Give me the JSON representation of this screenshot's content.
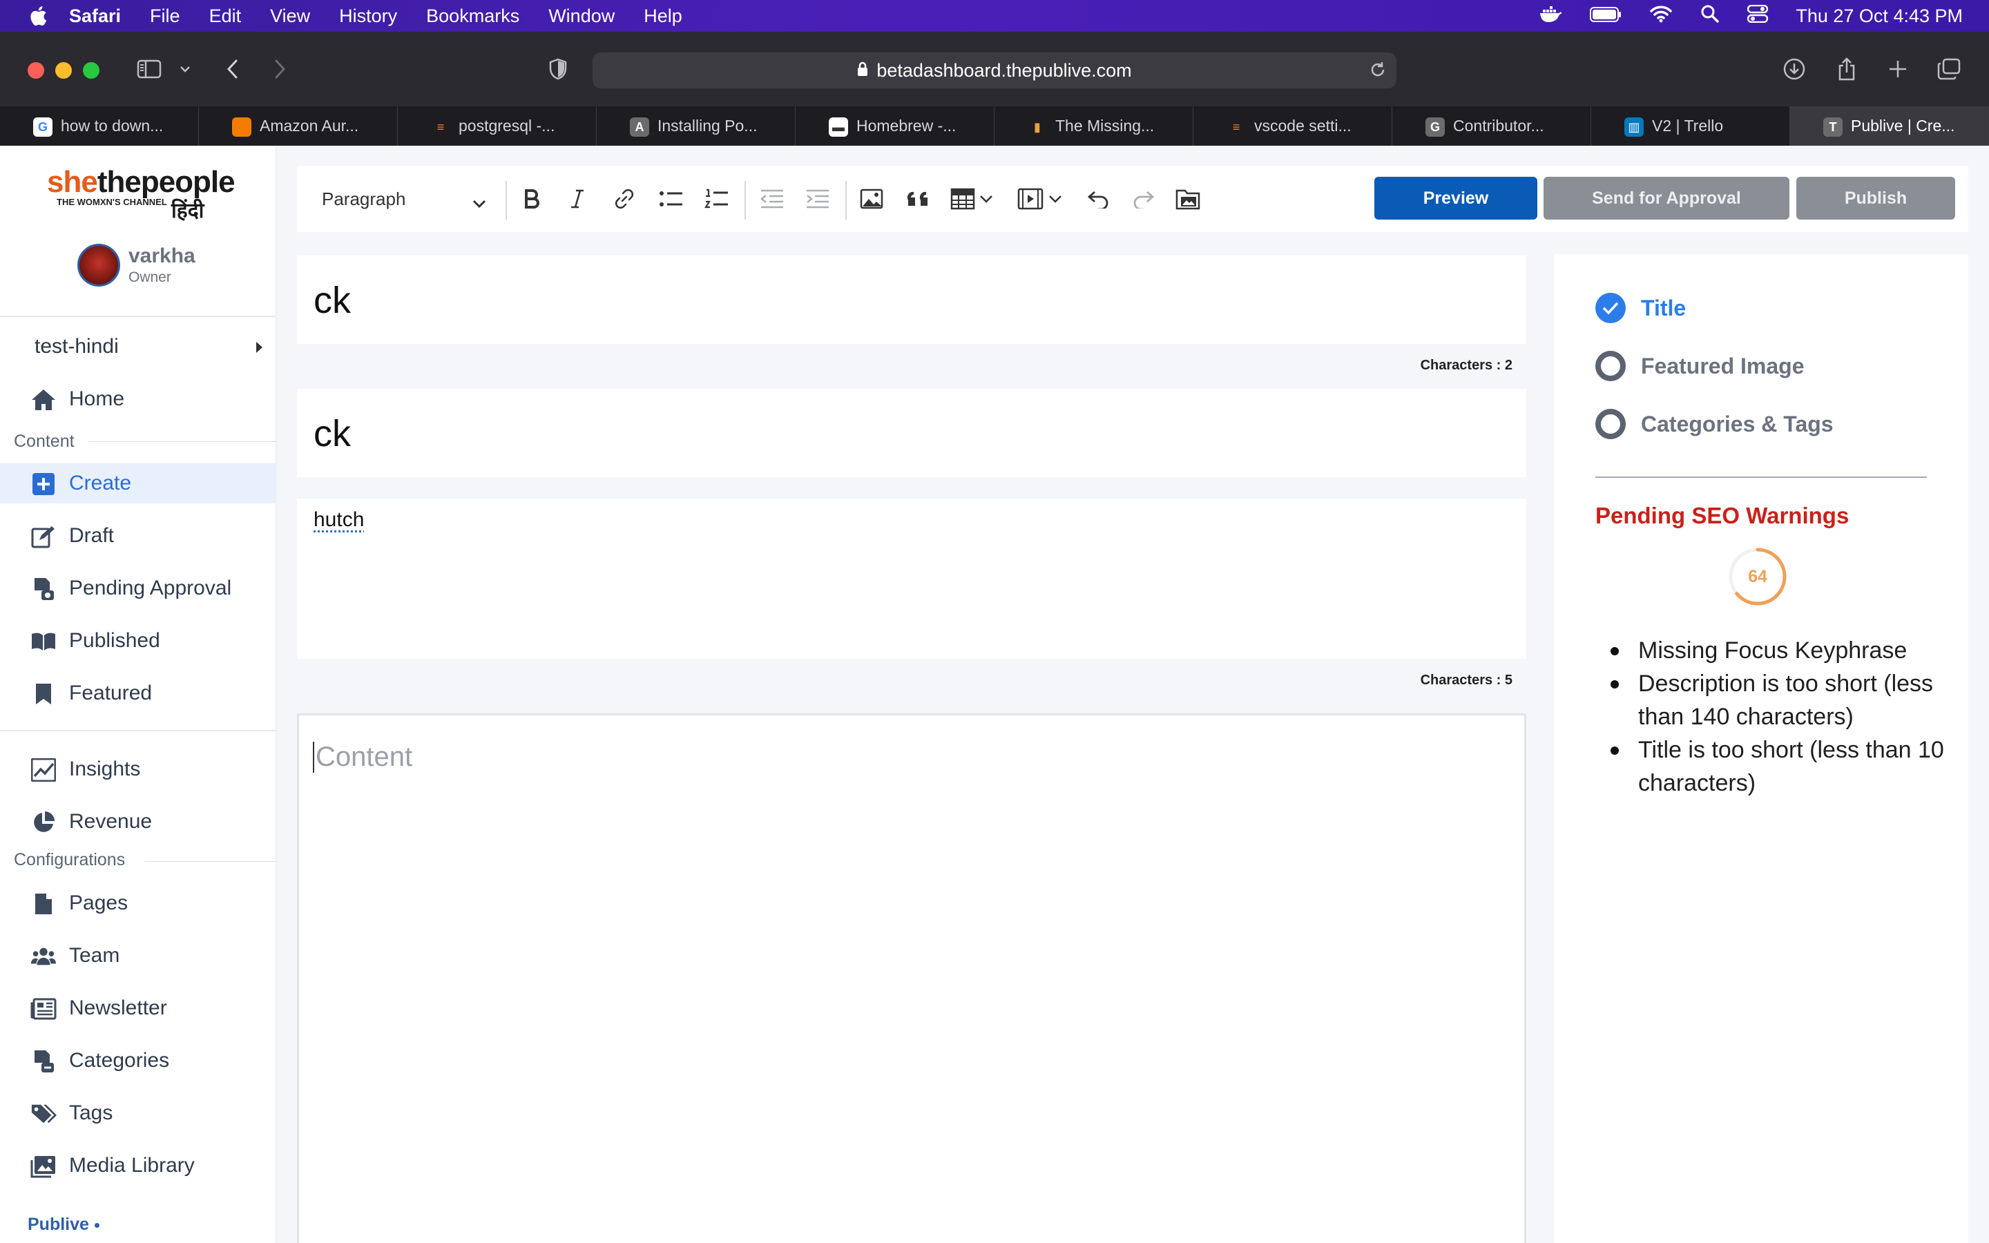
{
  "menubar": {
    "app": "Safari",
    "items": [
      "File",
      "Edit",
      "View",
      "History",
      "Bookmarks",
      "Window",
      "Help"
    ],
    "clock": "Thu 27 Oct  4:43 PM"
  },
  "browser": {
    "url": "betadashboard.thepublive.com",
    "tabs": [
      {
        "label": "how to down...",
        "favicon": "G",
        "color": "#ffffff"
      },
      {
        "label": "Amazon Aur...",
        "favicon": "",
        "color": "#f57c00"
      },
      {
        "label": "postgresql -...",
        "favicon": "",
        "color": "#f48024"
      },
      {
        "label": "Installing Po...",
        "favicon": "A",
        "color": "#6b6b6b"
      },
      {
        "label": "Homebrew -...",
        "favicon": "",
        "color": "#ffffff"
      },
      {
        "label": "The Missing...",
        "favicon": "",
        "color": "#e8a33c"
      },
      {
        "label": "vscode setti...",
        "favicon": "",
        "color": "#f48024"
      },
      {
        "label": "Contributor...",
        "favicon": "G",
        "color": "#6b6b6b"
      },
      {
        "label": "V2 | Trello",
        "favicon": "",
        "color": "#0079bf"
      },
      {
        "label": "Publive | Cre...",
        "favicon": "T",
        "color": "#6b6b6b"
      }
    ]
  },
  "sidebar": {
    "logo": {
      "she": "she",
      "rest": "thepeople",
      "tagline": "THE WOMXN'S CHANNEL",
      "hindi": "हिंदी"
    },
    "user": {
      "name": "varkha",
      "role": "Owner"
    },
    "site": "test-hindi",
    "home": "Home",
    "content_label": "Content",
    "content_items": [
      "Create",
      "Draft",
      "Pending Approval",
      "Published",
      "Featured"
    ],
    "analytics_items": [
      "Insights",
      "Revenue"
    ],
    "config_label": "Configurations",
    "config_items": [
      "Pages",
      "Team",
      "Newsletter",
      "Categories",
      "Tags",
      "Media Library"
    ],
    "brand": "Publive"
  },
  "editor": {
    "block_type": "Paragraph",
    "buttons": {
      "preview": "Preview",
      "approval": "Send for Approval",
      "publish": "Publish"
    },
    "title": "ck",
    "title_counter": "Characters : 2",
    "subtitle": "ck",
    "description": "hutch",
    "description_counter": "Characters :  5",
    "content_placeholder": "Content"
  },
  "panel": {
    "checklist": [
      {
        "label": "Title",
        "done": true
      },
      {
        "label": "Featured Image",
        "done": false
      },
      {
        "label": "Categories & Tags",
        "done": false
      }
    ],
    "seo_title": "Pending SEO Warnings",
    "score": 64,
    "warnings": [
      "Missing Focus Keyphrase",
      "Description is too short (less than 140 characters)",
      "Title is too short (less than 10 characters)"
    ]
  },
  "colors": {
    "accent": "#2b7de9",
    "primary_button": "#0a5bb5",
    "warning": "#c8211a",
    "score": "#f0a057"
  }
}
